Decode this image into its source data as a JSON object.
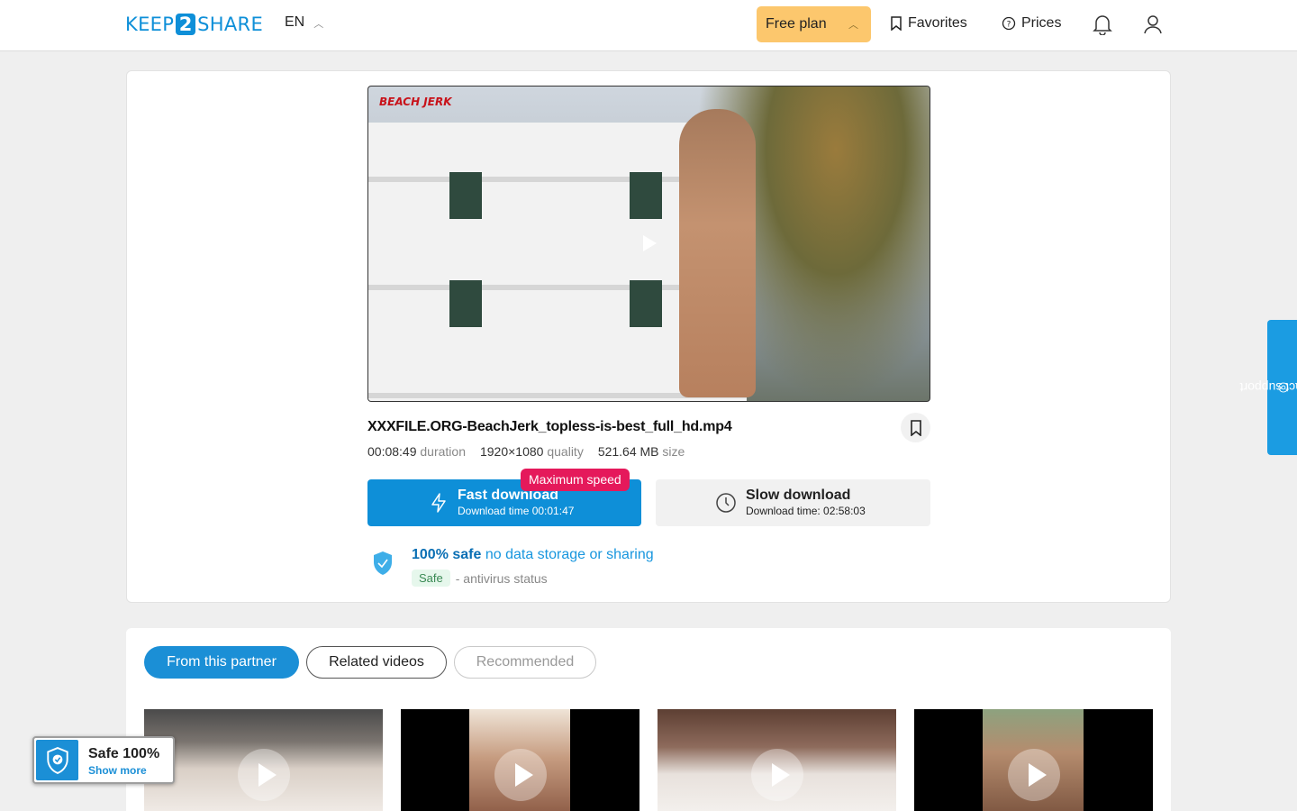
{
  "header": {
    "logo_left": "KEEP",
    "logo_num": "2",
    "logo_right": "SHARE",
    "language": "EN",
    "plan": "Free plan",
    "favorites": "Favorites",
    "prices": "Prices"
  },
  "video": {
    "watermark": "BEACH JERK"
  },
  "file": {
    "name": "XXXFILE.ORG-BeachJerk_topless-is-best_full_hd.mp4",
    "duration": "00:08:49",
    "duration_label": "duration",
    "quality": "1920×1080",
    "quality_label": "quality",
    "size": "521.64 MB",
    "size_label": "size"
  },
  "download": {
    "badge": "Maximum speed",
    "fast_title": "Fast download",
    "fast_sub": "Download time 00:01:47",
    "slow_title": "Slow download",
    "slow_sub": "Download time: 02:58:03"
  },
  "safety": {
    "strong": "100% safe",
    "rest": "no data storage or sharing",
    "badge": "Safe",
    "status": "- antivirus status"
  },
  "support": "contact support",
  "tabs": [
    "From this partner",
    "Related videos",
    "Recommended"
  ],
  "widget": {
    "title": "Safe 100%",
    "link": "Show more"
  },
  "colors": {
    "accent": "#0e8fd8",
    "plan": "#fcc76d",
    "badge": "#e5195b"
  }
}
